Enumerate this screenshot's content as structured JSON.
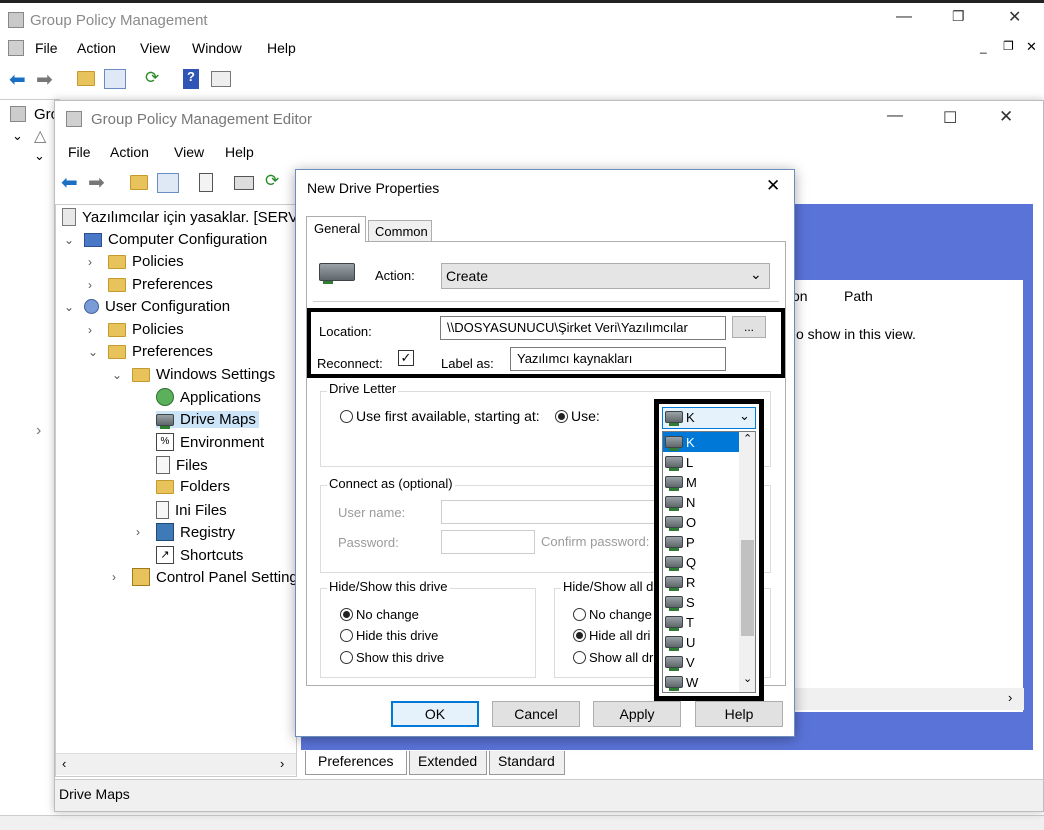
{
  "gpm": {
    "title": "Group Policy Management",
    "menu": [
      "File",
      "Action",
      "View",
      "Window",
      "Help"
    ],
    "tree_partial": "Gro"
  },
  "editor": {
    "title": "Group Policy Management Editor",
    "menu": [
      "File",
      "Action",
      "View",
      "Help"
    ],
    "tree": {
      "root": "Yazılımcılar için yasaklar. [SERVE",
      "computer_config": "Computer Configuration",
      "cc_policies": "Policies",
      "cc_preferences": "Preferences",
      "user_config": "User Configuration",
      "uc_policies": "Policies",
      "uc_preferences": "Preferences",
      "windows_settings": "Windows Settings",
      "applications": "Applications",
      "drive_maps": "Drive Maps",
      "environment": "Environment",
      "files": "Files",
      "folders": "Folders",
      "ini_files": "Ini Files",
      "registry": "Registry",
      "shortcuts": "Shortcuts",
      "control_panel": "Control Panel Setting"
    },
    "right_pane": {
      "col_partial": "on",
      "col_path": "Path",
      "empty_msg": "o show in this view."
    },
    "bottom_tabs": [
      "Preferences",
      "Extended",
      "Standard"
    ],
    "status": "Drive Maps"
  },
  "dialog": {
    "title": "New Drive Properties",
    "tabs": [
      "General",
      "Common"
    ],
    "action_label": "Action:",
    "action_value": "Create",
    "location_label": "Location:",
    "location_value": "\\\\DOSYASUNUCU\\Şirket Veri\\Yazılımcılar",
    "browse_label": "...",
    "reconnect_label": "Reconnect:",
    "label_as_label": "Label as:",
    "label_as_value": "Yazılımcı kaynakları",
    "drive_letter_group": "Drive Letter",
    "use_first_label": "Use first available, starting at:",
    "use_label": "Use:",
    "selected_letter": "K",
    "letters": [
      "K",
      "L",
      "M",
      "N",
      "O",
      "P",
      "Q",
      "R",
      "S",
      "T",
      "U",
      "V",
      "W"
    ],
    "connect_as_group": "Connect as (optional)",
    "username_label": "User name:",
    "password_label": "Password:",
    "confirm_password_label": "Confirm password:",
    "hide_show_drive_group": "Hide/Show this drive",
    "no_change": "No change",
    "hide_this_drive": "Hide this drive",
    "show_this_drive": "Show this drive",
    "hide_show_all_group": "Hide/Show all d",
    "no_change_all": "No change",
    "hide_all": "Hide all dri",
    "show_all": "Show all dr",
    "ok": "OK",
    "cancel": "Cancel",
    "apply": "Apply",
    "help": "Help"
  },
  "colors": {
    "accent_blue": "#0078d7",
    "annotation_border": "#000000",
    "right_pane_bg": "#5a73d8"
  }
}
